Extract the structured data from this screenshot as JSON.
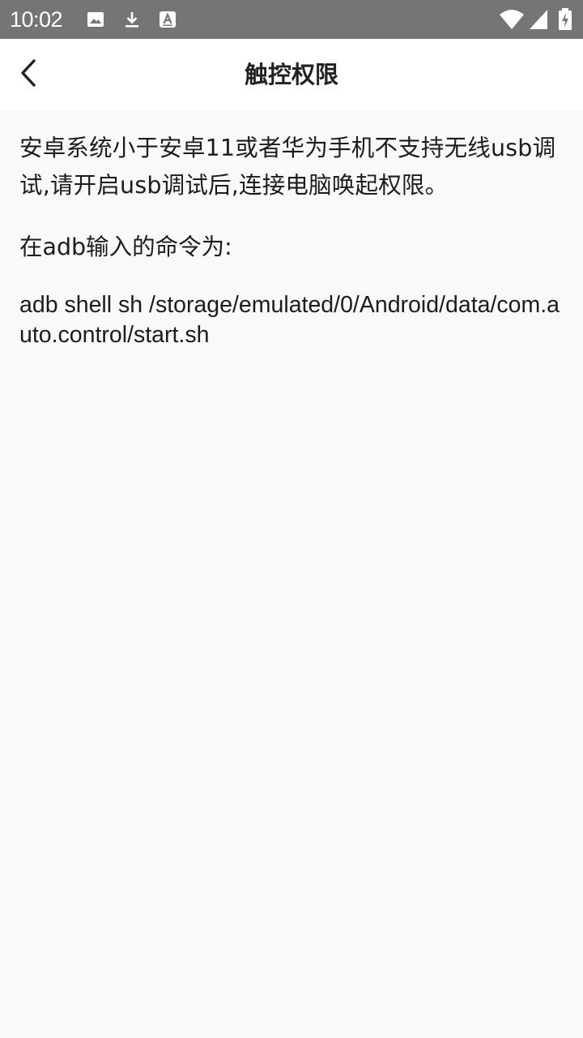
{
  "status_bar": {
    "time": "10:02",
    "left_icons": [
      "image-icon",
      "download-icon",
      "font-a-icon"
    ],
    "right_icons": [
      "wifi-icon",
      "cell-signal-icon",
      "battery-charging-icon"
    ],
    "background": "#757575"
  },
  "header": {
    "title": "触控权限",
    "back_icon": "chevron-left-icon"
  },
  "content": {
    "description": "安卓系统小于安卓11或者华为手机不支持无线usb调试,请开启usb调试后,连接电脑唤起权限。",
    "command_label": "在adb输入的命令为:",
    "command": "adb shell sh /storage/emulated/0/Android/data/com.auto.control/start.sh"
  }
}
